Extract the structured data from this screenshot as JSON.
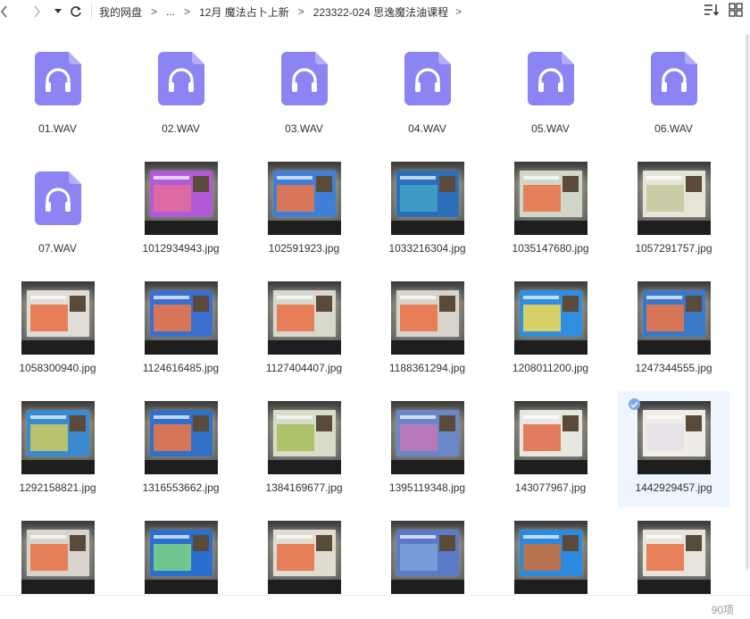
{
  "toolbar": {
    "breadcrumb": [
      "我的网盘",
      "...",
      "12月 魔法占卜上新",
      "223322-024 思逸魔法油课程"
    ],
    "breadcrumb_sep": ">",
    "back_icon": "chevron-left-icon",
    "forward_icon": "chevron-right-icon",
    "history_icon": "caret-down-icon",
    "refresh_icon": "refresh-icon",
    "sort_icon": "sort-icon",
    "view_icon": "grid-view-icon"
  },
  "colors": {
    "audio_bg": "#8b84f2",
    "audio_fold": "#b4aef8",
    "selection": "#eef5ff",
    "check": "#7fa9e8"
  },
  "files": [
    {
      "name": "01.WAV",
      "type": "audio"
    },
    {
      "name": "02.WAV",
      "type": "audio"
    },
    {
      "name": "03.WAV",
      "type": "audio"
    },
    {
      "name": "04.WAV",
      "type": "audio"
    },
    {
      "name": "05.WAV",
      "type": "audio"
    },
    {
      "name": "06.WAV",
      "type": "audio"
    },
    {
      "name": "07.WAV",
      "type": "audio"
    },
    {
      "name": "1012934943.jpg",
      "type": "image",
      "slide": "#b05ad8",
      "blk": "#e26aa0"
    },
    {
      "name": "102591923.jpg",
      "type": "image",
      "slide": "#3f7fd8",
      "blk": "#e8764a"
    },
    {
      "name": "1033216304.jpg",
      "type": "image",
      "slide": "#2a6fb8",
      "blk": "#3fa0c8"
    },
    {
      "name": "1035147680.jpg",
      "type": "image",
      "slide": "#cfd8c8",
      "blk": "#e8764a"
    },
    {
      "name": "1057291757.jpg",
      "type": "image",
      "slide": "#e6e4d8",
      "blk": "#c8c8a0"
    },
    {
      "name": "1058300940.jpg",
      "type": "image",
      "slide": "#e0dcd6",
      "blk": "#e8764a"
    },
    {
      "name": "1124616485.jpg",
      "type": "image",
      "slide": "#3a6fd0",
      "blk": "#e8764a"
    },
    {
      "name": "1127404407.jpg",
      "type": "image",
      "slide": "#d8d8cc",
      "blk": "#e8764a"
    },
    {
      "name": "1188361294.jpg",
      "type": "image",
      "slide": "#d8d4cc",
      "blk": "#e8764a"
    },
    {
      "name": "1208011200.jpg",
      "type": "image",
      "slide": "#2f8ee0",
      "blk": "#e8d85a"
    },
    {
      "name": "1247344555.jpg",
      "type": "image",
      "slide": "#3a78c8",
      "blk": "#e8764a"
    },
    {
      "name": "1292158821.jpg",
      "type": "image",
      "slide": "#3a8ad0",
      "blk": "#c8c860"
    },
    {
      "name": "1316553662.jpg",
      "type": "image",
      "slide": "#3070c8",
      "blk": "#e8764a"
    },
    {
      "name": "1384169677.jpg",
      "type": "image",
      "slide": "#d8dcc8",
      "blk": "#a8c060"
    },
    {
      "name": "1395119348.jpg",
      "type": "image",
      "slide": "#6a88c8",
      "blk": "#c078b8"
    },
    {
      "name": "143077967.jpg",
      "type": "image",
      "slide": "#e8e6e0",
      "blk": "#e07050"
    },
    {
      "name": "1442929457.jpg",
      "type": "image",
      "slide": "#f0ece8",
      "blk": "#e8e0e8",
      "selected": true
    },
    {
      "name": "",
      "type": "image",
      "slide": "#d8d4cc",
      "blk": "#e8764a"
    },
    {
      "name": "",
      "type": "image",
      "slide": "#2a6fd0",
      "blk": "#7ad088"
    },
    {
      "name": "",
      "type": "image",
      "slide": "#e0dcd0",
      "blk": "#e8764a"
    },
    {
      "name": "",
      "type": "image",
      "slide": "#5a7ac8",
      "blk": "#7aa0d8"
    },
    {
      "name": "",
      "type": "image",
      "slide": "#2a8ae0",
      "blk": "#c87040"
    },
    {
      "name": "",
      "type": "image",
      "slide": "#e8e4dc",
      "blk": "#e8764a"
    }
  ],
  "status": {
    "count": "90项"
  }
}
